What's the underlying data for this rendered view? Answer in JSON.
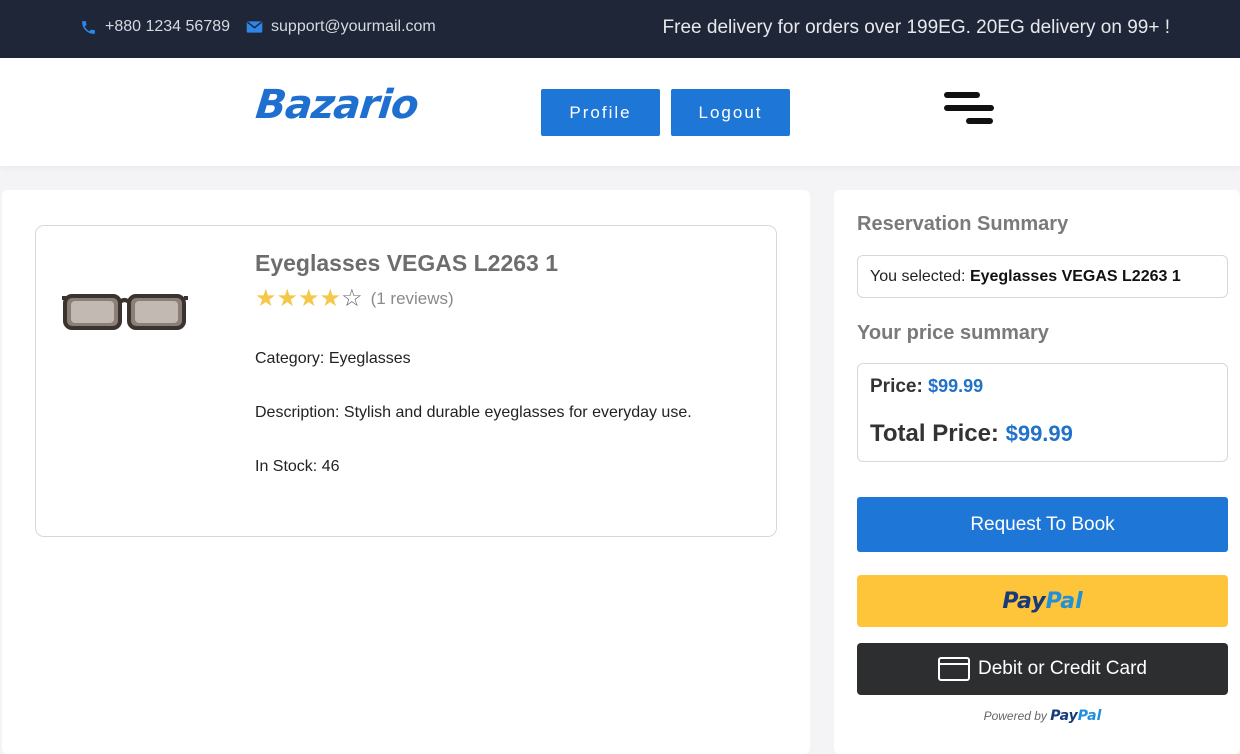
{
  "topbar": {
    "phone": "+880 1234 56789",
    "email": "support@yourmail.com",
    "promo": "Free delivery for orders over 199EG. 20EG delivery on 99+ !",
    "phone_icon": "phone-icon",
    "email_icon": "envelope-icon"
  },
  "header": {
    "logo": "Bazario",
    "profile_label": "Profile",
    "logout_label": "Logout",
    "menu_icon": "hamburger-menu-icon"
  },
  "product": {
    "title": "Eyeglasses VEGAS L2263 1",
    "rating": 4,
    "rating_max": 5,
    "reviews": "(1 reviews)",
    "category": "Category: Eyeglasses",
    "description": "Description: Stylish and durable eyeglasses for everyday use.",
    "stock": "In Stock: 46",
    "image_icon": "eyeglasses-image"
  },
  "summary": {
    "heading": "Reservation Summary",
    "selected_prefix": "You selected:",
    "selected_item": "Eyeglasses VEGAS L2263 1",
    "price_heading": "Your price summary",
    "price_label": "Price:",
    "price_value": "$99.99",
    "total_label": "Total Price:",
    "total_value": "$99.99",
    "book_label": "Request To Book",
    "paypal_a": "Pay",
    "paypal_b": "Pal",
    "card_label": "Debit or Credit Card",
    "powered_by": "Powered by"
  },
  "colors": {
    "accent": "#1e77d6",
    "topbar": "#1e2637",
    "paypal_yellow": "#fec43a",
    "card_dark": "#2c2e2f",
    "star": "#f5c84a"
  }
}
